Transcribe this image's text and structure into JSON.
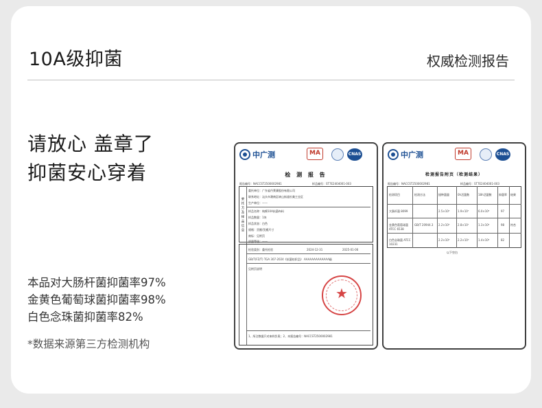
{
  "header": {
    "title": "10A级抑菌",
    "right_title": "权威检测报告"
  },
  "headline": {
    "line1": "请放心 盖章了",
    "line2": "抑菌安心穿着"
  },
  "rates": [
    "本品对大肠杆菌抑菌率97%",
    "金黄色葡萄球菌抑菌率98%",
    "白色念珠菌抑菌率82%"
  ],
  "note": "*数据来源第三方检测机构",
  "report1": {
    "brand": "中广测",
    "ma": "MA",
    "cnas": "CNAS",
    "title": "检 测 报 告",
    "report_no": "报告编号：NACCST2500002981",
    "sample_no": "样品编号：ST7E2404001-003",
    "client": "委托单位：广东省丹莱康股份有限公司",
    "address": "联系地址：汕头市潮南区峡山街道杉美工业区",
    "producer": "生产单位：——",
    "sample_name": "样品名称：纯棉10A抗菌布料",
    "quantity": "样品数量：1块",
    "state": "样品状态：白色",
    "package": "规格：货搬/货搬尺寸",
    "trademark": "商标：见附页",
    "grade": "质量等级：——",
    "test_type": "检验类别：委托检验",
    "date_received": "2024-12-31",
    "date_done": "2025-01-06",
    "standard": "GB/T(FZ/T) TGA 307-2024《抗菌纺织品》 AAAAAAAAAAAAA级",
    "conclusion": "见附页说明",
    "remarks": "1、所注数据只对来样负责；2、本报告编号：NACCST2500002981",
    "side_label": "委托方及样品信息"
  },
  "report2": {
    "brand": "中广测",
    "ma": "MA",
    "cnas": "CNAS",
    "title": "检测报告附页（检测结果）",
    "report_no": "报告编号：NACCST2500002981",
    "sample_no": "样品编号：ST7E2404001-003",
    "columns": [
      "检测项目",
      "检测方法",
      "接种菌量",
      "0h活菌数",
      "18h活菌数",
      "抑菌率",
      "结果"
    ],
    "rows": [
      [
        "大肠杆菌 8099",
        "",
        "2.5×10⁵",
        "1.9×10⁷",
        "6.0×10⁵",
        "97",
        "—"
      ],
      [
        "金黄色葡萄球菌 ATCC 6538",
        "GB/T 20944.3",
        "2.2×10⁵",
        "2.8×10⁷",
        "1.3×10⁵",
        "98",
        "符合"
      ],
      [
        "白色念珠菌 ATCC 10231",
        "",
        "2.2×10⁵",
        "2.2×10⁶",
        "1.4×10⁵",
        "82",
        "—"
      ]
    ],
    "footer": "以下空白"
  }
}
